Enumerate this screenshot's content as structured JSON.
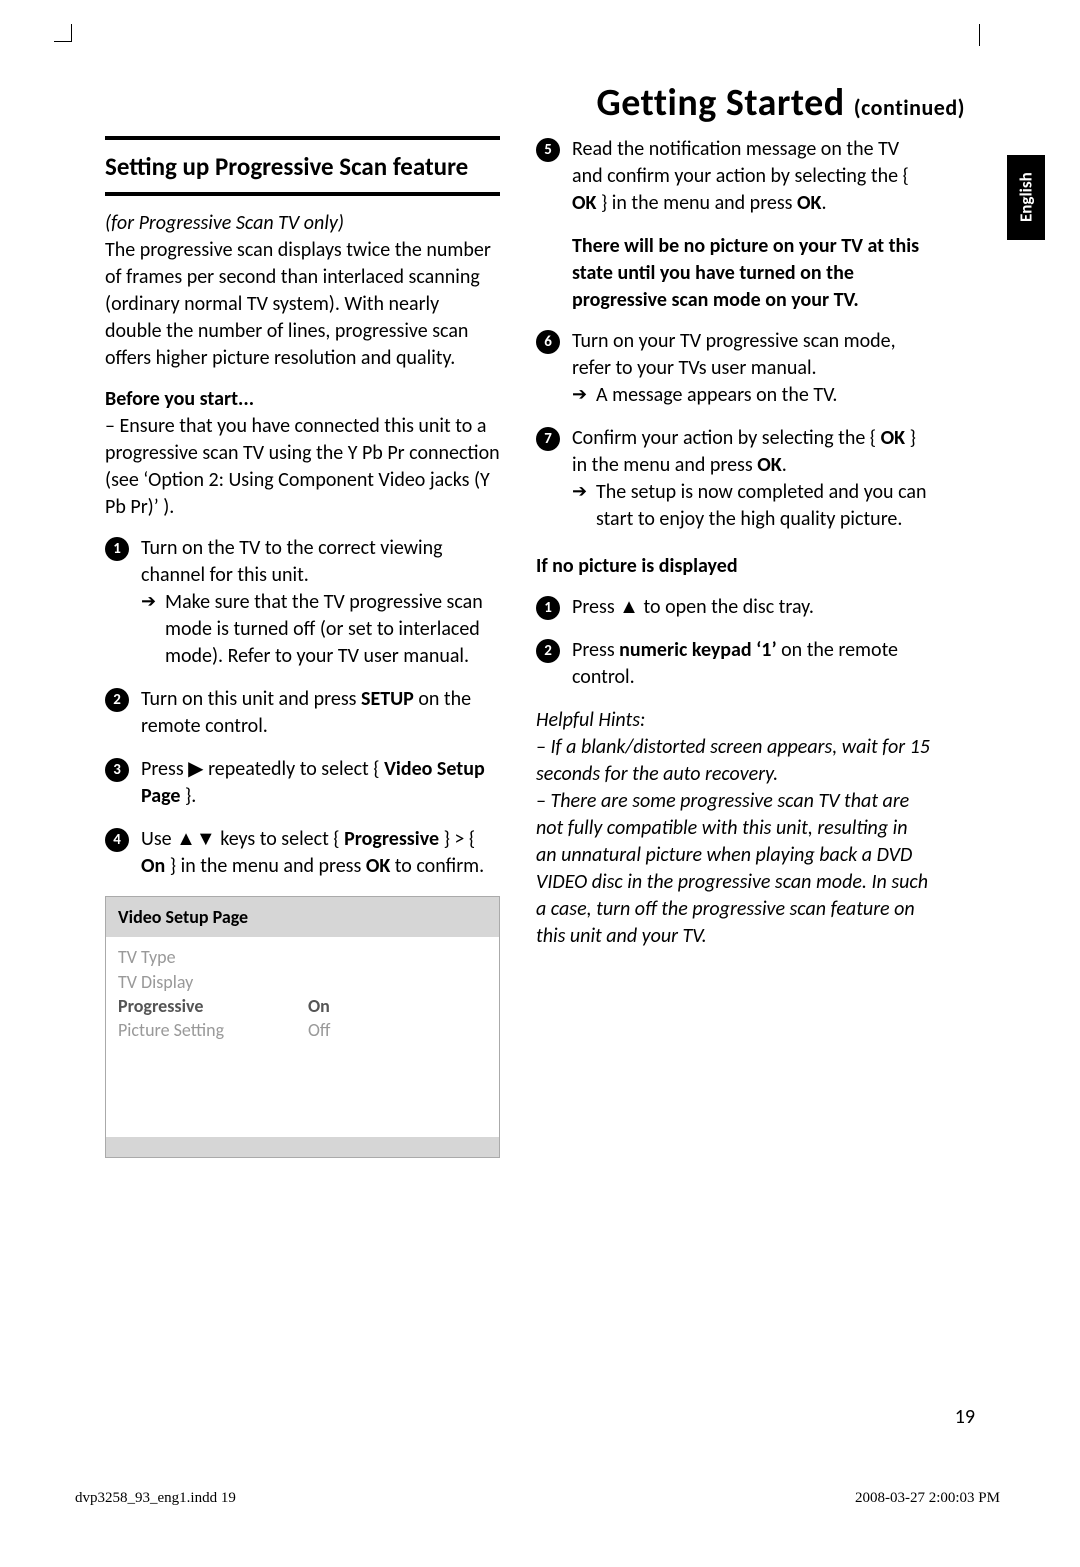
{
  "pageTitle": "Getting Started",
  "pageTitleCont": "(continued)",
  "langTab": "English",
  "sectionHead": "Setting up Progressive Scan feature",
  "leftCol": {
    "scanOnly": "(for Progressive Scan TV only)",
    "intro": "The progressive scan displays twice the number of frames per second than interlaced scanning (ordinary normal TV system). With nearly double the number of lines, progressive scan offers higher picture resolution and quality.",
    "beforeHead": "Before you start...",
    "beforeBody": "–  Ensure that you have connected this unit to a progressive scan TV using the Y Pb Pr connection (see ‘Option 2: Using Component Video jacks (Y Pb Pr)’ ).",
    "step1a": "Turn on the TV to the correct viewing channel for this unit.",
    "step1b": "Make sure that the TV progressive scan mode is turned off (or set to interlaced mode). Refer to your TV user manual.",
    "step2a": "Turn on this unit and press ",
    "step2b": "SETUP",
    "step2c": " on the remote control.",
    "step3a": "Press ",
    "step3b": " repeatedly to select { ",
    "step3c": "Video Setup Page",
    "step3d": " }.",
    "step4a": "Use ",
    "step4b": " keys to select { ",
    "step4c": "Progressive",
    "step4d": " } > { ",
    "step4e": "On",
    "step4f": " } in the menu and press ",
    "step4g": "OK",
    "step4h": " to confirm."
  },
  "menu": {
    "header": "Video Setup Page",
    "tvType": "TV Type",
    "tvDisplay": "TV Display",
    "progressive": "Progressive",
    "on": "On",
    "pictureSetting": "Picture Setting",
    "off": "Off"
  },
  "rightCol": {
    "step5a": "Read the notification message on the TV and confirm your action by selecting the { ",
    "step5b": "OK",
    "step5c": " } in the menu and press ",
    "step5d": "OK",
    "step5e": ".",
    "warn": "There will be no picture on your TV at this state until you have turned on the progressive scan mode on your TV.",
    "step6a": "Turn on your TV progressive scan mode, refer to your TVs user manual.",
    "step6b": "A message appears on the TV.",
    "step7a": "Confirm your action by selecting the { ",
    "step7b": "OK",
    "step7c": " } in the menu and press ",
    "step7d": "OK",
    "step7e": ".",
    "step7f": "The setup is now completed and you can start to enjoy the high quality picture.",
    "noPicHead": "If no picture is displayed",
    "np1a": "Press  ",
    "np1b": "  to open the disc tray.",
    "np2a": "Press ",
    "np2b": "numeric keypad ‘1’",
    "np2c": " on the remote control.",
    "hintsHead": "Helpful Hints:",
    "hint1": "–  If a blank/distorted screen appears, wait for 15 seconds for the auto recovery.",
    "hint2": "–  There are some progressive scan TV that are not fully compatible with this unit, resulting in an unnatural picture when playing back a DVD VIDEO disc in the progressive scan mode. In such a case, turn off the progressive scan feature on this unit and your TV."
  },
  "pageNumber": "19",
  "footerLeft": "dvp3258_93_eng1.indd   19",
  "footerRight": "2008-03-27   2:00:03 PM"
}
